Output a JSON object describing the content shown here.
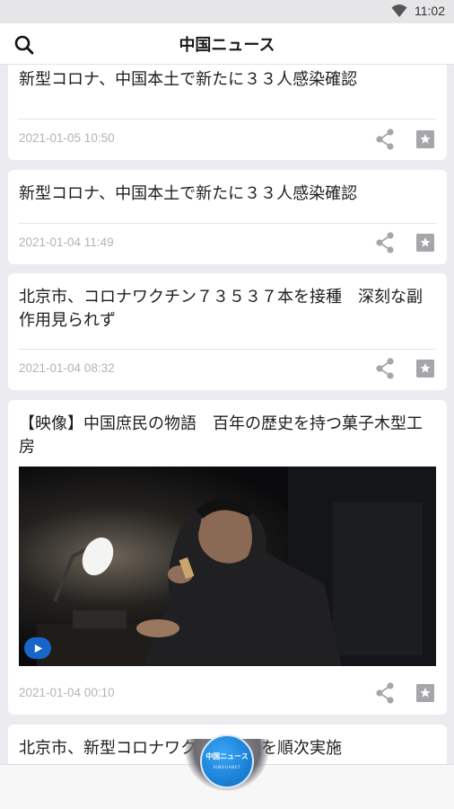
{
  "status_bar": {
    "time": "11:02",
    "wifi_icon": "wifi-icon"
  },
  "app_bar": {
    "title": "中国ニュース",
    "search_icon": "search-icon"
  },
  "articles": [
    {
      "title": "新型コロナ、中国本土で新たに３３人感染確認",
      "date": "2021-01-05 10:50"
    },
    {
      "title": "新型コロナ、中国本土で新たに３３人感染確認",
      "date": "2021-01-04 11:49"
    },
    {
      "title": "北京市、コロナワクチン７３５３７本を接種　深刻な副作用見られず",
      "date": "2021-01-04 08:32"
    },
    {
      "title": "【映像】中国庶民の物語　百年の歴史を持つ菓子木型工房",
      "date": "2021-01-04 00:10",
      "has_video": true
    },
    {
      "title": "北京市、新型コロナワクチン接種を順次実施"
    }
  ],
  "bottom_nav": {
    "fab_label": "中国ニュース",
    "fab_sub": "XINHUANET"
  },
  "colors": {
    "accent": "#1b82d8",
    "background": "#ececf0",
    "muted_text": "#b4b4b8",
    "icon_gray": "#a6a6aa"
  }
}
